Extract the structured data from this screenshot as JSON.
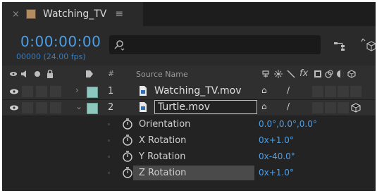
{
  "tab": {
    "close": "×",
    "title": "Watching_TV",
    "menu": "≡",
    "label_color": "#b28b5e"
  },
  "timecode": {
    "time": "0:00:00:00",
    "frames": "00000 (24.00 fps)",
    "color": "#4b9fe8"
  },
  "search": {
    "icon": "search-icon"
  },
  "header": {
    "hash": "#",
    "source_name": "Source Name"
  },
  "layers": [
    {
      "number": "1",
      "name": "Watching_TV.mov",
      "twirl": "›",
      "label_color": "#8cc8be"
    },
    {
      "number": "2",
      "name": "Turtle.mov",
      "twirl": "⌄",
      "label_color": "#8cc8be",
      "editing": true
    }
  ],
  "properties": [
    {
      "name": "Orientation",
      "value": "0.0°,0.0°,0.0°"
    },
    {
      "name": "X Rotation",
      "value": "0x+1.0°"
    },
    {
      "name": "Y Rotation",
      "value": "0x-40.0°"
    },
    {
      "name": "Z Rotation",
      "value": "0x+1.0°",
      "highlighted": true
    }
  ]
}
